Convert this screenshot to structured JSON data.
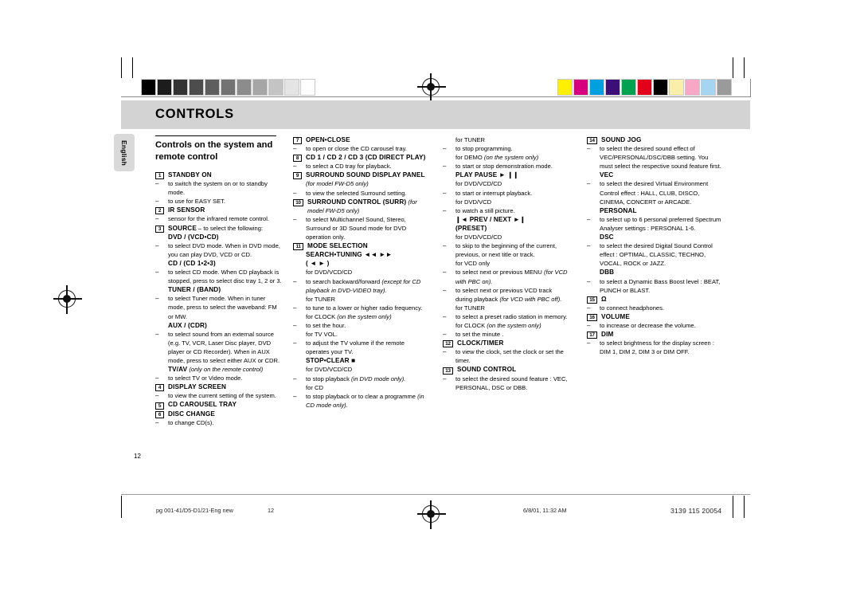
{
  "header": {
    "title": "CONTROLS",
    "language_tab": "English"
  },
  "folio": "12",
  "footer": {
    "file": "pg 001-41/D5-D1/21-Eng new",
    "page": "12",
    "date": "6/8/01, 11:32 AM",
    "code": "3139 115 20054"
  },
  "calibration": {
    "gray_bars": [
      "#000000",
      "#1c1c1c",
      "#333333",
      "#4d4d4d",
      "#5e5e5e",
      "#737373",
      "#8c8c8c",
      "#a6a6a6",
      "#c4c4c4",
      "#e4e4e4",
      "#ffffff"
    ],
    "color_bars": [
      "#ffef00",
      "#d6007f",
      "#00a0e0",
      "#3b0e78",
      "#00a251",
      "#e2001a",
      "#000000",
      "#faeeab",
      "#f8a8c4",
      "#a6d5f2",
      "#9a9a9a"
    ]
  },
  "columns": [
    {
      "heading": "Controls on the system and remote control",
      "entries": [
        {
          "num": "1",
          "label": "STANDBY ON",
          "lines": [
            {
              "marker": "dash",
              "text": "to switch the system on or to standby mode."
            },
            {
              "marker": "dash",
              "text": "to use for EASY SET."
            }
          ]
        },
        {
          "num": "2",
          "label": "IR SENSOR",
          "lines": [
            {
              "marker": "dash",
              "text": "sensor for the infrared remote control."
            }
          ]
        },
        {
          "num": "3",
          "label": "SOURCE",
          "label_suffix": " – to select the following:",
          "sublabels": [
            {
              "label": "DVD / (VCD•CD)",
              "lines": [
                {
                  "marker": "dash",
                  "text": "to select DVD mode. When in DVD mode, you can play DVD, VCD or CD."
                }
              ]
            },
            {
              "label": "CD / (CD 1•2•3)",
              "lines": [
                {
                  "marker": "dash",
                  "text": "to select CD mode. When CD playback is stopped, press to select disc tray 1, 2 or 3."
                }
              ]
            },
            {
              "label": "TUNER / (BAND)",
              "lines": [
                {
                  "marker": "dash",
                  "text": "to select Tuner mode. When in tuner mode, press to select the waveband: FM or MW."
                }
              ]
            },
            {
              "label": "AUX / (CDR)",
              "lines": [
                {
                  "marker": "dash",
                  "text": "to select sound from an external source (e.g. TV, VCR, Laser Disc player, DVD player or CD Recorder).  When in AUX mode, press to select either AUX or CDR."
                }
              ]
            },
            {
              "label": "TV/AV",
              "label_italic": " (only on the remote control)",
              "lines": [
                {
                  "marker": "dash",
                  "text": "to select TV or Video mode."
                }
              ]
            }
          ]
        },
        {
          "num": "4",
          "label": "DISPLAY SCREEN",
          "lines": [
            {
              "marker": "dash",
              "text": "to view the current setting of the system."
            }
          ]
        },
        {
          "num": "5",
          "label": "CD CAROUSEL TRAY",
          "lines": []
        },
        {
          "num": "6",
          "label": "DISC CHANGE",
          "lines": [
            {
              "marker": "dash",
              "text": "to change CD(s)."
            }
          ]
        }
      ]
    },
    {
      "entries": [
        {
          "num": "7",
          "label": "OPEN•CLOSE",
          "lines": [
            {
              "marker": "dash",
              "text": "to open or close the CD carousel tray."
            }
          ]
        },
        {
          "num": "8",
          "label": "CD 1 / CD 2 / CD 3 (CD DIRECT PLAY)",
          "lines": [
            {
              "marker": "dash",
              "text": "to select a CD tray for playback."
            }
          ]
        },
        {
          "num": "9",
          "label": "SURROUND  SOUND DISPLAY PANEL",
          "label_italic": " (for model FW-D5 only)",
          "lines": [
            {
              "marker": "dash",
              "text": "to view the selected Surround setting."
            }
          ]
        },
        {
          "num": "10",
          "label": "SURROUND CONTROL (SURR)",
          "label_italic": " (for model FW-D5 only)",
          "lines": [
            {
              "marker": "dash",
              "text": "to select Multichannel Sound, Stereo, Surround or 3D Sound mode for DVD operation only."
            }
          ]
        },
        {
          "num": "11",
          "label": "MODE SELECTION",
          "sublabels": [
            {
              "label": "SEARCH•TUNING ◄◄ ►►",
              "label2": "( ◄ ► )",
              "groups": [
                {
                  "context": "for DVD/VCD/CD",
                  "lines": [
                    {
                      "marker": "dash",
                      "text": "to search backward/forward ",
                      "italic_tail": "(except for CD playback in DVD-VIDEO tray)."
                    }
                  ]
                },
                {
                  "context": "for TUNER",
                  "lines": [
                    {
                      "marker": "dash",
                      "text": "to tune to a lower or higher radio frequency."
                    }
                  ]
                },
                {
                  "context": "for CLOCK ",
                  "context_italic": "(on the system only)",
                  "lines": [
                    {
                      "marker": "dash",
                      "text": "to set the hour."
                    }
                  ]
                },
                {
                  "context": "for TV VOL.",
                  "lines": [
                    {
                      "marker": "dash",
                      "text": "to adjust the TV volume if the remote operates your TV."
                    }
                  ]
                }
              ]
            },
            {
              "label": "STOP•CLEAR ■",
              "groups": [
                {
                  "context": "for DVD/VCD/CD",
                  "lines": [
                    {
                      "marker": "dash",
                      "text": "to stop playback ",
                      "italic_tail": "(in DVD mode only)."
                    }
                  ]
                },
                {
                  "context": "for CD",
                  "lines": [
                    {
                      "marker": "dash",
                      "text": "to stop playback or to clear a programme ",
                      "italic_tail": "(in CD mode only)."
                    }
                  ]
                }
              ]
            }
          ]
        }
      ]
    },
    {
      "entries": [
        {
          "continuation": true,
          "groups": [
            {
              "context": "for TUNER",
              "lines": [
                {
                  "marker": "dash",
                  "text": "to stop programming."
                }
              ]
            },
            {
              "context": "for DEMO ",
              "context_italic": "(on the system only)",
              "lines": [
                {
                  "marker": "dash",
                  "text": "to start or stop demonstration mode."
                }
              ]
            }
          ]
        },
        {
          "label": "PLAY PAUSE ► ❙❙",
          "no_num": true,
          "groups": [
            {
              "context": "for DVD/VCD/CD",
              "lines": [
                {
                  "marker": "dash",
                  "text": "to start or interrupt playback."
                }
              ]
            },
            {
              "context": "for DVD/VCD",
              "lines": [
                {
                  "marker": "dash",
                  "text": "to watch a still picture."
                }
              ]
            }
          ]
        },
        {
          "label": "❙◄ PREV / NEXT ►❙",
          "label2": "(PRESET)",
          "no_num": true,
          "groups": [
            {
              "context": "for DVD/VCD/CD",
              "lines": [
                {
                  "marker": "dash",
                  "text": "to skip to the beginning of the current, previous, or next title or track."
                }
              ]
            },
            {
              "context": "for VCD only",
              "lines": [
                {
                  "marker": "dash",
                  "text": "to select next or previous MENU ",
                  "italic_tail": "(for VCD with PBC on)."
                },
                {
                  "marker": "dash",
                  "text": "to select next or previous VCD track during playback ",
                  "italic_tail": "(for VCD with PBC off)."
                }
              ]
            },
            {
              "context": "for TUNER",
              "lines": [
                {
                  "marker": "dash",
                  "text": "to select a preset radio station in memory."
                }
              ]
            },
            {
              "context": "for CLOCK ",
              "context_italic": "(on the system only)",
              "lines": [
                {
                  "marker": "dash",
                  "text": "to set the minute ."
                }
              ]
            }
          ]
        },
        {
          "num": "12",
          "label": "CLOCK/TIMER",
          "lines": [
            {
              "marker": "dash",
              "text": "to view the clock, set the clock or set the timer."
            }
          ]
        },
        {
          "num": "13",
          "label": "SOUND CONTROL",
          "lines": [
            {
              "marker": "dash",
              "text": "to select the desired sound feature : VEC, PERSONAL, DSC or DBB."
            }
          ]
        }
      ]
    },
    {
      "entries": [
        {
          "num": "14",
          "label": "SOUND JOG",
          "lines": [
            {
              "marker": "dash",
              "text": "to select the desired sound effect of VEC/PERSONAL/DSC/DBB setting. You must select the respective sound feature first."
            }
          ],
          "sublabels": [
            {
              "label": "VEC",
              "lines": [
                {
                  "marker": "dash",
                  "text": "to select the desired Virtual Environment Control effect : HALL, CLUB, DISCO, CINEMA, CONCERT or ARCADE."
                }
              ]
            },
            {
              "label": "PERSONAL",
              "lines": [
                {
                  "marker": "dash",
                  "text": "to select up to 6 personal preferred Spectrum Analyser settings : PERSONAL 1-6."
                }
              ]
            },
            {
              "label": "DSC",
              "lines": [
                {
                  "marker": "dash",
                  "text": "to select the desired Digital Sound Control effect : OPTIMAL, CLASSIC, TECHNO, VOCAL, ROCK or JAZZ."
                }
              ]
            },
            {
              "label": "DBB",
              "lines": [
                {
                  "marker": "dash",
                  "text": "to select a Dynamic Bass Boost level : BEAT, PUNCH or BLAST."
                }
              ]
            }
          ]
        },
        {
          "num": "15",
          "label": "Ω",
          "label_is_icon": "headphone-icon",
          "lines": [
            {
              "marker": "dash",
              "text": "to connect headphones."
            }
          ]
        },
        {
          "num": "16",
          "label": "VOLUME",
          "lines": [
            {
              "marker": "dash",
              "text": "to increase or decrease the volume."
            }
          ]
        },
        {
          "num": "17",
          "label": "DIM",
          "lines": [
            {
              "marker": "dash",
              "text": "to select brightness for the display screen : DIM 1, DIM 2, DIM 3 or DIM OFF."
            }
          ]
        }
      ]
    }
  ]
}
